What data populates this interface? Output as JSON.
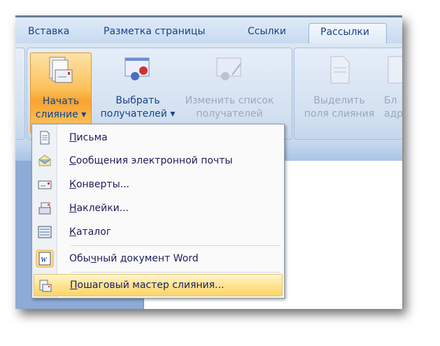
{
  "tabs": [
    "Вставка",
    "Разметка страницы",
    "Ссылки",
    "Рассылки"
  ],
  "ribbon": {
    "start_merge": {
      "line1": "Начать",
      "line2": "слияние"
    },
    "select_recipients": {
      "line1": "Выбрать",
      "line2": "получателей"
    },
    "edit_list": {
      "line1": "Изменить список",
      "line2": "получателей"
    },
    "highlight_fields": {
      "line1": "Выделить",
      "line2": "поля слияния"
    },
    "address_block": {
      "line1": "Бл",
      "line2": "адр"
    }
  },
  "menu": {
    "items": [
      {
        "u": "П",
        "rest": "исьма",
        "icon": "letter-icon"
      },
      {
        "u": "С",
        "rest": "ообщения электронной почты",
        "icon": "email-icon"
      },
      {
        "u": "К",
        "rest": "онверты...",
        "icon": "envelope-icon"
      },
      {
        "u": "Н",
        "rest": "аклейки...",
        "icon": "labels-icon"
      },
      {
        "u": "К",
        "rest": "аталог",
        "icon": "directory-icon"
      }
    ],
    "normal_doc": {
      "pre": "Обы",
      "u": "ч",
      "rest": "ный документ Word"
    },
    "wizard": {
      "u": "П",
      "rest": "ошаговый мастер слияния..."
    }
  }
}
